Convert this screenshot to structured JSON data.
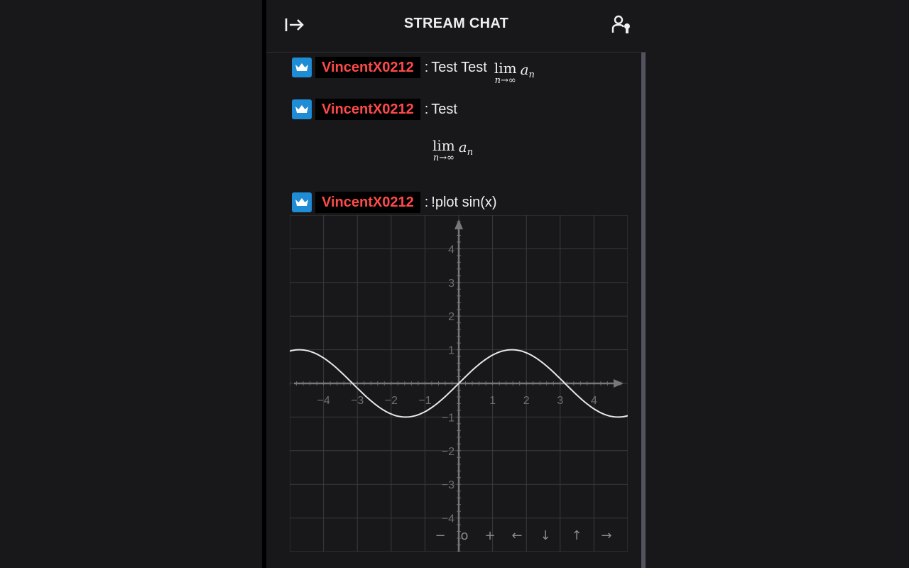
{
  "header": {
    "title": "STREAM CHAT",
    "collapse_icon": "arrow-right-bar-icon",
    "users_icon": "users-icon"
  },
  "colors": {
    "background": "#18181b",
    "username": "#ff4a4a",
    "badge": "#1f8cd6",
    "text": "#efeff1"
  },
  "messages": [
    {
      "badge_icon": "crown-icon",
      "username": "VincentX0212",
      "separator": ":",
      "text": "Test Test",
      "math": {
        "operator": "lim",
        "subscript": "n→∞",
        "term": "a",
        "term_sub": "n"
      }
    },
    {
      "badge_icon": "crown-icon",
      "username": "VincentX0212",
      "separator": ":",
      "text": "Test",
      "display_math": {
        "operator": "lim",
        "subscript": "n→∞",
        "term": "a",
        "term_sub": "n"
      }
    },
    {
      "badge_icon": "crown-icon",
      "username": "VincentX0212",
      "separator": ":",
      "text": "!plot sin(x)"
    }
  ],
  "plot_controls": [
    "−",
    "o",
    "+",
    "←",
    "↓",
    "↑",
    "→"
  ],
  "chart_data": {
    "type": "line",
    "function": "sin(x)",
    "xlim": [
      -5,
      5
    ],
    "ylim": [
      -5,
      5
    ],
    "x_ticks": [
      "−4",
      "−3",
      "−2",
      "−1",
      "1",
      "2",
      "3",
      "4"
    ],
    "y_ticks": [
      "4",
      "3",
      "2",
      "1",
      "−1",
      "−2",
      "−3",
      "−4"
    ],
    "grid": true,
    "series": [
      {
        "x": [
          -5.0,
          -4.5,
          -4.0,
          -3.5,
          -3.0,
          -2.5,
          -2.0,
          -1.5,
          -1.0,
          -0.5,
          0.0,
          0.5,
          1.0,
          1.5,
          2.0,
          2.5,
          3.0,
          3.5,
          4.0,
          4.5,
          5.0
        ],
        "values": [
          0.96,
          0.98,
          0.76,
          0.35,
          -0.14,
          -0.6,
          -0.91,
          -1.0,
          -0.84,
          -0.48,
          0.0,
          0.48,
          0.84,
          1.0,
          0.91,
          0.6,
          0.14,
          -0.35,
          -0.76,
          -0.98,
          -0.96
        ]
      }
    ]
  }
}
